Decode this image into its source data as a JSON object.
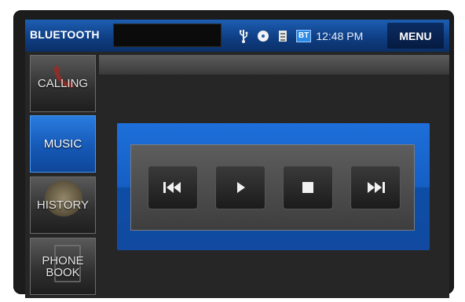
{
  "header": {
    "title": "BLUETOOTH",
    "clock": "12:48 PM",
    "bt_badge": "BT",
    "menu_label": "MENU",
    "status_icons": [
      "usb-icon",
      "cd-icon",
      "device-icon",
      "bluetooth-icon"
    ]
  },
  "sidebar": {
    "items": [
      {
        "label": "CALLING",
        "icon": "phone-icon"
      },
      {
        "label": "MUSIC",
        "icon": "music-icon"
      },
      {
        "label": "HISTORY",
        "icon": "clock-icon"
      },
      {
        "label": "PHONE BOOK",
        "icon": "book-icon"
      }
    ],
    "active": "MUSIC"
  },
  "controls": {
    "buttons": [
      "previous-track",
      "play",
      "stop",
      "next-track"
    ]
  },
  "colors": {
    "accent": "#1659b6",
    "bar": "#0f3f85",
    "panel": "#155fc4"
  }
}
